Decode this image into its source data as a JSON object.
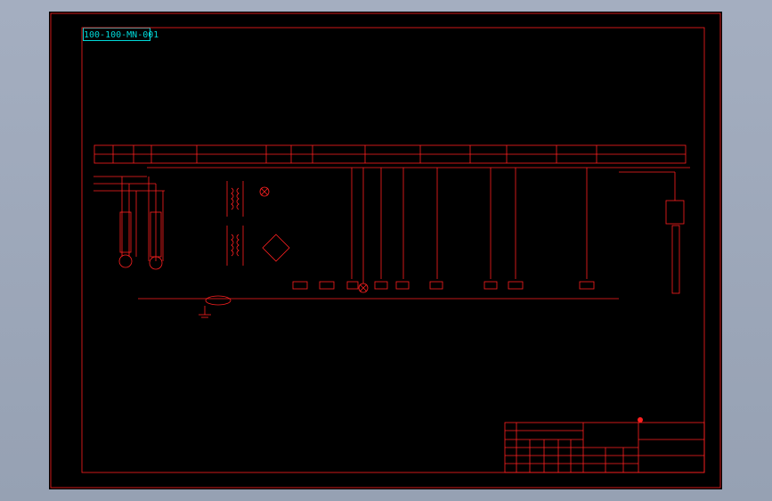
{
  "drawing": {
    "drawing_code": "100-100-MN-001",
    "colors": {
      "background": "#000000",
      "frame": "#ff2020",
      "code_label": "#00d8d8",
      "viewport_bg": "#9ba6b8"
    }
  }
}
